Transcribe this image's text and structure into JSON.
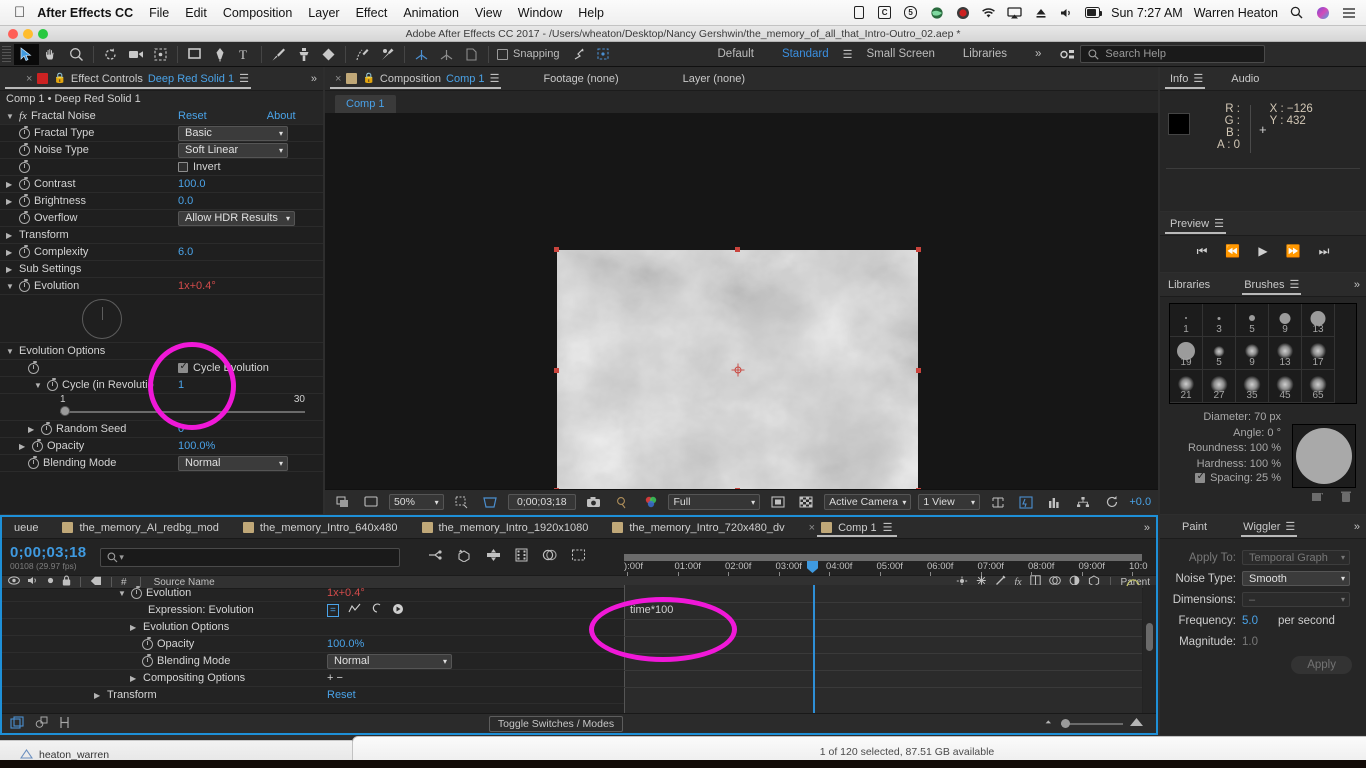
{
  "macmenu": {
    "apple": "apple-logo",
    "app": "After Effects CC",
    "items": [
      "File",
      "Edit",
      "Composition",
      "Layer",
      "Effect",
      "Animation",
      "View",
      "Window",
      "Help"
    ],
    "status": {
      "time": "Sun 7:27 AM",
      "user": "Warren Heaton",
      "battery_icon": "battery-icon",
      "wifi_icon": "wifi-icon",
      "volume_icon": "volume-icon",
      "search_icon": "spotlight-icon",
      "siri_icon": "siri-icon",
      "notif_icon": "notification-center-icon"
    }
  },
  "titlebar": {
    "title": "Adobe After Effects CC 2017 - /Users/wheaton/Desktop/Nancy Gershwin/the_memory_of_all_that_Intro-Outro_02.aep *"
  },
  "toolbar": {
    "snapping_label": "Snapping",
    "workspaces": [
      "Default",
      "Standard",
      "Small Screen",
      "Libraries"
    ],
    "active_workspace": "Standard",
    "overflow": "»",
    "search_placeholder": "Search Help"
  },
  "effect_controls": {
    "tab_prefix": "Effect Controls",
    "tab_target": "Deep Red Solid 1",
    "breadcrumb": "Comp 1 • Deep Red Solid 1",
    "effect_name": "Fractal Noise",
    "reset": "Reset",
    "about": "About",
    "rows": [
      {
        "label": "Fractal Type",
        "value": "Basic",
        "type": "dropdown"
      },
      {
        "label": "Noise Type",
        "value": "Soft Linear",
        "type": "dropdown"
      },
      {
        "label": "",
        "value": "Invert",
        "type": "checkbox",
        "checked": false
      },
      {
        "label": "Contrast",
        "value": "100.0",
        "type": "number"
      },
      {
        "label": "Brightness",
        "value": "0.0",
        "type": "number"
      },
      {
        "label": "Overflow",
        "value": "Allow HDR Results",
        "type": "dropdown"
      },
      {
        "label": "Transform",
        "value": "",
        "type": "group"
      },
      {
        "label": "Complexity",
        "value": "6.0",
        "type": "number"
      },
      {
        "label": "Sub Settings",
        "value": "",
        "type": "group"
      },
      {
        "label": "Evolution",
        "value": "1x+0.4°",
        "type": "angle"
      }
    ],
    "evolution_options": {
      "header": "Evolution Options",
      "cycle_evolution_label": "Cycle Evolution",
      "cycle_evolution_checked": true,
      "cycle_label": "Cycle (in Revolutio",
      "cycle_value": "1",
      "slider_min": "1",
      "slider_max": "30",
      "random_seed_label": "Random Seed",
      "random_seed_value": "0"
    },
    "opacity_label": "Opacity",
    "opacity_value": "100.0%",
    "blending_label": "Blending Mode",
    "blending_value": "Normal"
  },
  "composition": {
    "tab_prefix": "Composition",
    "tab_name": "Comp 1",
    "footage_tab": "Footage (none)",
    "layer_tab": "Layer (none)",
    "subtab": "Comp 1",
    "footer": {
      "zoom": "50%",
      "time": "0;00;03;18",
      "resolution": "Full",
      "view": "Active Camera",
      "views": "1 View",
      "exposure": "+0.0"
    }
  },
  "info": {
    "tab": "Info",
    "audio_tab": "Audio",
    "R": "R :",
    "G": "G :",
    "B": "B :",
    "A": "A : 0",
    "X": "X : −126",
    "Y": "Y : 432"
  },
  "preview": {
    "tab": "Preview"
  },
  "brushes": {
    "libraries_tab": "Libraries",
    "brushes_tab": "Brushes",
    "cells": [
      {
        "num": "1",
        "size": 2,
        "soft": false
      },
      {
        "num": "3",
        "size": 3,
        "soft": false
      },
      {
        "num": "5",
        "size": 6,
        "soft": false
      },
      {
        "num": "9",
        "size": 11,
        "soft": false
      },
      {
        "num": "13",
        "size": 15,
        "soft": false
      },
      {
        "num": "19",
        "size": 18,
        "soft": false
      },
      {
        "num": "5",
        "size": 3,
        "soft": true
      },
      {
        "num": "9",
        "size": 6,
        "soft": true
      },
      {
        "num": "13",
        "size": 8,
        "soft": true
      },
      {
        "num": "17",
        "size": 8,
        "soft": true
      },
      {
        "num": "21",
        "size": 8,
        "soft": true
      },
      {
        "num": "27",
        "size": 9,
        "soft": true
      },
      {
        "num": "35",
        "size": 9,
        "soft": true
      },
      {
        "num": "45",
        "size": 9,
        "soft": true
      },
      {
        "num": "65",
        "size": 9,
        "soft": true
      }
    ],
    "diameter": "Diameter: 70 px",
    "angle": "Angle: 0 °",
    "roundness": "Roundness: 100 %",
    "hardness": "Hardness: 100 %",
    "spacing": "Spacing: 25 %"
  },
  "paint_panel": {
    "paint_tab": "Paint",
    "wiggler_tab": "Wiggler",
    "apply_to_label": "Apply To:",
    "apply_to_value": "Temporal Graph",
    "noise_type_label": "Noise Type:",
    "noise_type_value": "Smooth",
    "dimensions_label": "Dimensions:",
    "dimensions_value": "–",
    "frequency_label": "Frequency:",
    "frequency_value": "5.0",
    "frequency_unit": "per second",
    "magnitude_label": "Magnitude:",
    "magnitude_value": "1.0",
    "apply_button": "Apply"
  },
  "timeline": {
    "tabs": [
      {
        "label": "ueue",
        "active": false,
        "swatch": false
      },
      {
        "label": "the_memory_AI_redbg_mod",
        "active": false,
        "swatch": true
      },
      {
        "label": "the_memory_Intro_640x480",
        "active": false,
        "swatch": true
      },
      {
        "label": "the_memory_Intro_1920x1080",
        "active": false,
        "swatch": true
      },
      {
        "label": "the_memory_Intro_720x480_dv",
        "active": false,
        "swatch": true
      },
      {
        "label": "Comp 1",
        "active": true,
        "swatch": true
      }
    ],
    "current_time": "0;00;03;18",
    "frame_info": "00108 (29.97 fps)",
    "search_placeholder": "",
    "columns": [
      "#",
      "Source Name",
      "Parent"
    ],
    "rows": [
      {
        "indent": 116,
        "label": "Evolution",
        "value": "1x+0.4°",
        "value_class": "red",
        "tri": "down",
        "stopwatch": true
      },
      {
        "indent": 146,
        "label": "Expression: Evolution",
        "value": "",
        "value_class": "",
        "tri": "",
        "stopwatch": false
      },
      {
        "indent": 128,
        "label": "Evolution Options",
        "value": "",
        "value_class": "",
        "tri": "right",
        "stopwatch": false
      },
      {
        "indent": 140,
        "label": "Opacity",
        "value": "100.0%",
        "value_class": "blue",
        "tri": "",
        "stopwatch": true
      },
      {
        "indent": 140,
        "label": "Blending Mode",
        "value": "Normal",
        "value_class": "",
        "tri": "",
        "stopwatch": true
      },
      {
        "indent": 128,
        "label": "Compositing Options",
        "value": "+ −",
        "value_class": "",
        "tri": "right",
        "stopwatch": false
      },
      {
        "indent": 92,
        "label": "Transform",
        "value": "Reset",
        "value_class": "blue",
        "tri": "right",
        "stopwatch": false
      }
    ],
    "expression_text": "time*100",
    "ruler_labels": [
      "):00f",
      "01:00f",
      "02:00f",
      "03:00f",
      "04:00f",
      "05:00f",
      "06:00f",
      "07:00f",
      "08:00f",
      "09:00f",
      "10:0"
    ],
    "toggle_switches": "Toggle Switches / Modes"
  },
  "finder": {
    "status": "1 of 120 selected, 87.51 GB available",
    "sidebar_item": "heaton_warren"
  },
  "colors": {
    "accent_blue": "#3f9ae0",
    "annotation_magenta": "#f018d8",
    "value_red": "#d34b4b",
    "solid_red": "#cc2222"
  }
}
